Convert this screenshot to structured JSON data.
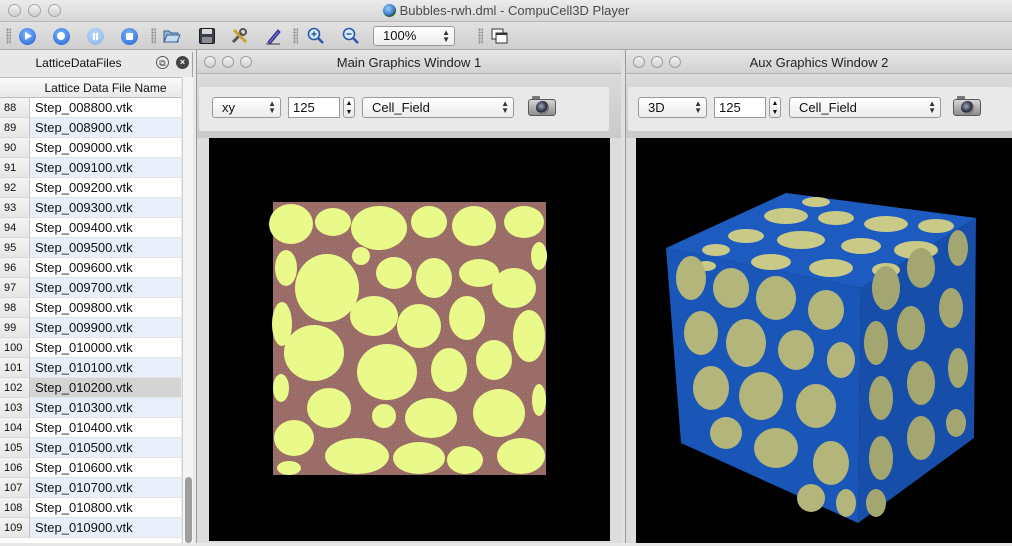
{
  "window": {
    "title": "Bubbles-rwh.dml - CompuCell3D Player"
  },
  "toolbar": {
    "buttons": [
      {
        "name": "run-simulation",
        "icon": "play-icon"
      },
      {
        "name": "step-simulation",
        "icon": "step-icon"
      },
      {
        "name": "pause-simulation",
        "icon": "pause-icon"
      },
      {
        "name": "stop-simulation",
        "icon": "stop-icon"
      },
      {
        "name": "open",
        "icon": "folder-open-icon"
      },
      {
        "name": "save",
        "icon": "save-icon"
      },
      {
        "name": "configure",
        "icon": "tools-icon"
      },
      {
        "name": "edit",
        "icon": "pencil-icon"
      },
      {
        "name": "zoom-in",
        "icon": "zoom-in-icon"
      },
      {
        "name": "zoom-out",
        "icon": "zoom-out-icon"
      },
      {
        "name": "tile-windows",
        "icon": "tile-windows-icon"
      }
    ],
    "zoom_value": "100%"
  },
  "dock": {
    "title": "LatticeDataFiles",
    "column_header": "Lattice Data File Name",
    "rows": [
      {
        "index": "88",
        "file": "Step_008800.vtk"
      },
      {
        "index": "89",
        "file": "Step_008900.vtk"
      },
      {
        "index": "90",
        "file": "Step_009000.vtk"
      },
      {
        "index": "91",
        "file": "Step_009100.vtk"
      },
      {
        "index": "92",
        "file": "Step_009200.vtk"
      },
      {
        "index": "93",
        "file": "Step_009300.vtk"
      },
      {
        "index": "94",
        "file": "Step_009400.vtk"
      },
      {
        "index": "95",
        "file": "Step_009500.vtk"
      },
      {
        "index": "96",
        "file": "Step_009600.vtk"
      },
      {
        "index": "97",
        "file": "Step_009700.vtk"
      },
      {
        "index": "98",
        "file": "Step_009800.vtk"
      },
      {
        "index": "99",
        "file": "Step_009900.vtk"
      },
      {
        "index": "100",
        "file": "Step_010000.vtk"
      },
      {
        "index": "101",
        "file": "Step_010100.vtk"
      },
      {
        "index": "102",
        "file": "Step_010200.vtk"
      },
      {
        "index": "103",
        "file": "Step_010300.vtk"
      },
      {
        "index": "104",
        "file": "Step_010400.vtk"
      },
      {
        "index": "105",
        "file": "Step_010500.vtk"
      },
      {
        "index": "106",
        "file": "Step_010600.vtk"
      },
      {
        "index": "107",
        "file": "Step_010700.vtk"
      },
      {
        "index": "108",
        "file": "Step_010800.vtk"
      },
      {
        "index": "109",
        "file": "Step_010900.vtk"
      }
    ],
    "selected_index": "102"
  },
  "main_window": {
    "title": "Main Graphics Window 1",
    "projection": "xy",
    "slice": "125",
    "field": "Cell_Field"
  },
  "aux_window": {
    "title": "Aux Graphics Window 2",
    "projection": "3D",
    "slice": "125",
    "field": "Cell_Field"
  },
  "colors": {
    "background": "#000000",
    "cell_yellow": "#e9f98a",
    "medium_brown": "#a0675f",
    "cube_blue": "#1e5bc0",
    "cube_cells": "#b6b779"
  }
}
